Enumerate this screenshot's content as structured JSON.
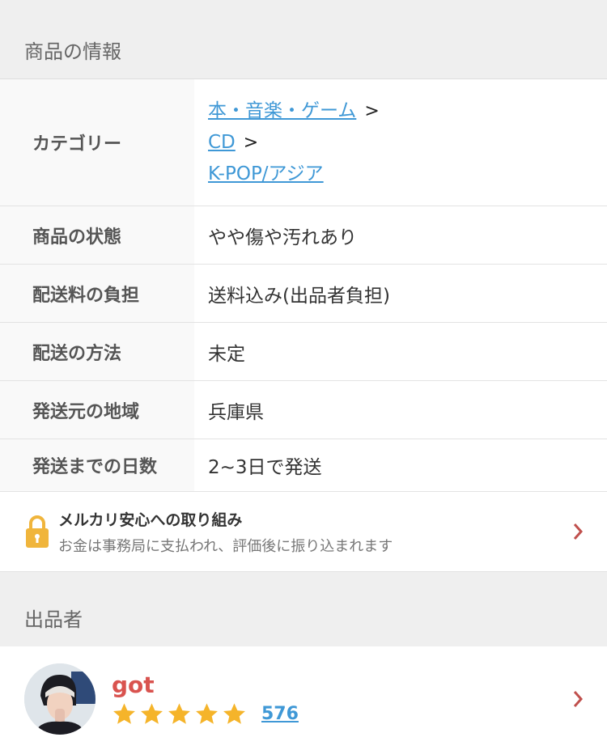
{
  "product_info": {
    "section_title": "商品の情報",
    "category": {
      "label": "カテゴリー",
      "links": [
        "本・音楽・ゲーム",
        "CD",
        "K-POP/アジア"
      ],
      "separator": ">"
    },
    "rows": [
      {
        "label": "商品の状態",
        "value": "やや傷や汚れあり"
      },
      {
        "label": "配送料の負担",
        "value": "送料込み(出品者負担)"
      },
      {
        "label": "配送の方法",
        "value": "未定"
      },
      {
        "label": "発送元の地域",
        "value": "兵庫県"
      },
      {
        "label": "発送までの日数",
        "value": "2~3日で発送"
      }
    ]
  },
  "safety": {
    "title": "メルカリ安心への取り組み",
    "description": "お金は事務局に支払われ、評価後に振り込まれます",
    "icon": "lock-icon"
  },
  "seller": {
    "section_title": "出品者",
    "name": "got",
    "stars": 5,
    "rating_count": "576"
  },
  "colors": {
    "link": "#3f98d6",
    "seller_name": "#d9534f",
    "star": "#f5b42a",
    "chevron": "#c0504d"
  }
}
